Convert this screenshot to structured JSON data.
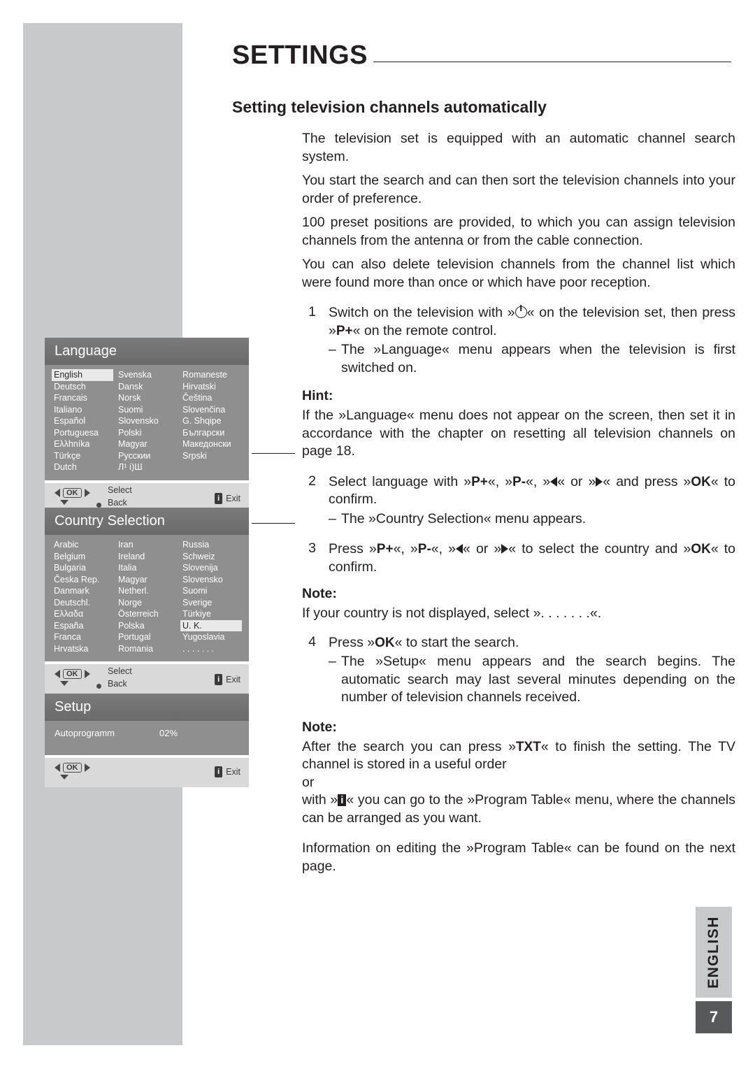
{
  "header": {
    "title": "SETTINGS",
    "subtitle": "Setting television channels automatically"
  },
  "body": {
    "p1": "The television set is equipped with an automatic channel search system.",
    "p2": "You start the search and can then sort the television channels into your order of preference.",
    "p3": "100 preset positions are provided, to which you can assign television channels from the antenna or from the cable connection.",
    "p4": "You can also delete television channels from the channel list which were found more than once or which have poor reception.",
    "step1": {
      "num": "1",
      "text_a": "Switch on the television with »",
      "text_b": "« on the television set, then press »",
      "key": "P+",
      "text_c": "« on the remote control.",
      "sub": "The »Language« menu appears when the television is first switched on."
    },
    "hint_label": "Hint:",
    "hint_text": "If the »Language« menu does not appear on the screen, then set it in accordance with the chapter on resetting all television channels on page 18.",
    "step2": {
      "num": "2",
      "a": "Select language with »",
      "k1": "P+",
      "b": "«, »",
      "k2": "P-",
      "c": "«, »",
      "d": "« or »",
      "e": "« and press »",
      "k3": "OK",
      "f": "« to confirm.",
      "sub": "The »Country Selection« menu appears."
    },
    "step3": {
      "num": "3",
      "a": "Press »",
      "k1": "P+",
      "b": "«, »",
      "k2": "P-",
      "c": "«, »",
      "d": "« or »",
      "e": "« to select the country and »",
      "k3": "OK",
      "f": "« to confirm."
    },
    "note1_label": "Note:",
    "note1_text": "If your country is not displayed, select ». . . . . . .«.",
    "step4": {
      "num": "4",
      "a": "Press »",
      "k1": "OK",
      "b": "« to start the search.",
      "sub": "The »Setup« menu appears and the search begins. The automatic search may last several minutes depending on the number of television channels received."
    },
    "note2_label": "Note:",
    "note2_a": "After the search you can press »",
    "note2_k": "TXT",
    "note2_b": "« to finish the setting. The TV channel is stored in a useful order",
    "note2_or": "or",
    "note2_c": "with »",
    "note2_d": "« you can go to the »Program Table« menu, where the channels can be arranged as you want.",
    "p_last": "Information on editing the »Program Table« can be found on the next page."
  },
  "osd": {
    "language": {
      "title": "Language",
      "selected": "English",
      "items": [
        "English",
        "Svenska",
        "Romaneste",
        "Deutsch",
        "Dansk",
        "Hirvatski",
        "Francais",
        "Norsk",
        "Čeština",
        "Italiano",
        "Suomi",
        "Slovenčina",
        "Español",
        "Slovensko",
        "G. Shqipe",
        "Portuguesa",
        "Polski",
        "Български",
        "Ελλhníka",
        "Magyar",
        "Македонски",
        "Türkçe",
        "Русскии",
        "Srpski",
        "Dutch",
        "Л¹ וֹ)Ш",
        ""
      ],
      "footer": {
        "select": "Select",
        "back": "Back",
        "exit": "Exit",
        "exit_icon": "i"
      }
    },
    "country": {
      "title": "Country Selection",
      "selected": "U. K.",
      "items": [
        "Arabic",
        "Iran",
        "Russia",
        "Belgium",
        "Ireland",
        "Schweiz",
        "Bulgaria",
        "Italia",
        "Slovenija",
        "Česka Rep.",
        "Magyar",
        "Slovensko",
        "Danmark",
        "Netherl.",
        "Suomi",
        "Deutschl.",
        "Norge",
        "Sverige",
        "Ελλαδα",
        "Österreich",
        "Türkiye",
        "España",
        "Polska",
        "U. K.",
        "Franca",
        "Portugal",
        "Yugoslavia",
        "Hrvatska",
        "Romania",
        ". . . . . . ."
      ],
      "footer": {
        "select": "Select",
        "back": "Back",
        "exit": "Exit",
        "exit_icon": "i"
      }
    },
    "setup": {
      "title": "Setup",
      "row_label": "Autoprogramm",
      "row_value": "02%",
      "footer": {
        "exit": "Exit",
        "exit_icon": "i"
      }
    }
  },
  "side": {
    "language_tab": "ENGLISH",
    "page_number": "7"
  }
}
